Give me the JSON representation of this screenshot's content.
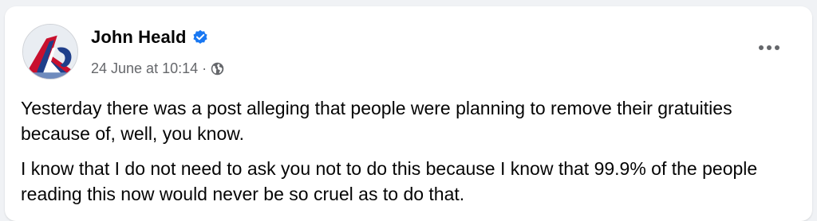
{
  "post": {
    "author_name": "John Heald",
    "verified": true,
    "timestamp": "24 June at 10:14",
    "separator": "·",
    "privacy_icon": "globe-icon",
    "more_icon": "more-options-icon",
    "paragraphs": [
      "Yesterday there was a post alleging that people were planning to remove their gratuities because of, well, you know.",
      "I know that I do not need to ask you not to do this because I know that 99.9% of the people reading this now would never be so cruel as to do that."
    ]
  },
  "colors": {
    "verified_badge": "#1877f2",
    "meta_text": "#65676b",
    "body_text": "#050505",
    "page_background": "#f0f2f5"
  }
}
